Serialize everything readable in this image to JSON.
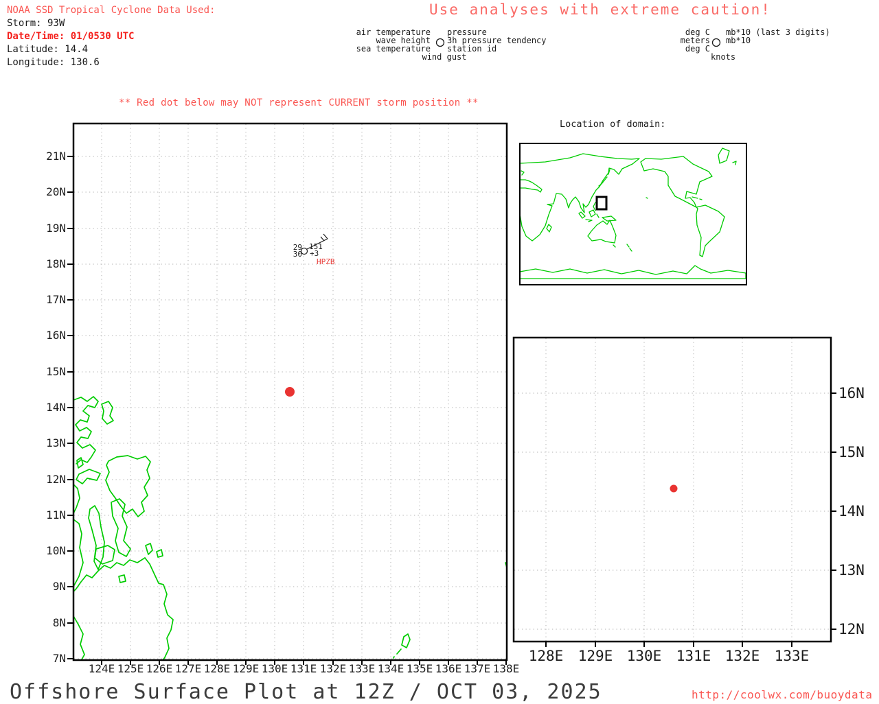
{
  "header": {
    "noaa_line": "NOAA SSD Tropical Cyclone Data Used:",
    "storm": "Storm: 93W",
    "datetime": "Date/Time: 01/0530 UTC",
    "latitude": "Latitude: 14.4",
    "longitude": "Longitude: 130.6"
  },
  "caution": "Use analyses with extreme caution!",
  "storm_warning": "** Red dot below may NOT represent CURRENT storm position **",
  "station_legend": {
    "air_temperature": "air temperature",
    "pressure": "pressure",
    "wave_height": "wave height",
    "pressure_tendency": "3h pressure tendency",
    "sea_temperature": "sea temperature",
    "station_id": "station id",
    "wind_gust": "wind gust"
  },
  "units_legend": {
    "air_temp_unit": "deg C",
    "pressure_unit": "mb*10 (last 3 digits)",
    "wave_height_unit": "meters",
    "tendency_unit": "mb*10",
    "sea_temp_unit": "deg C",
    "wind_gust_unit": "knots"
  },
  "main_map": {
    "lon_labels": [
      "124E",
      "125E",
      "126E",
      "127E",
      "128E",
      "129E",
      "130E",
      "131E",
      "132E",
      "133E",
      "134E",
      "135E",
      "136E",
      "137E",
      "138E"
    ],
    "lat_labels": [
      "21N",
      "20N",
      "19N",
      "18N",
      "17N",
      "16N",
      "15N",
      "14N",
      "13N",
      "12N",
      "11N",
      "10N",
      "9N",
      "8N",
      "7N"
    ],
    "storm_dot": {
      "longitude": 130.6,
      "latitude": 14.4
    },
    "station": {
      "air_temp": "29",
      "sea_temp": "30",
      "pressure": "151",
      "tendency": "+3",
      "id": "HPZB"
    }
  },
  "inset": {
    "title": "Location of domain:",
    "domain_box": {
      "lon_min": 123,
      "lon_max": 138,
      "lat_min": 7,
      "lat_max": 22
    }
  },
  "zoom_map": {
    "lon_labels": [
      "128E",
      "129E",
      "130E",
      "131E",
      "132E",
      "133E"
    ],
    "lat_labels": [
      "16N",
      "15N",
      "14N",
      "13N",
      "12N"
    ],
    "storm_dot": {
      "longitude": 130.6,
      "latitude": 14.4
    }
  },
  "footer": {
    "title": "Offshore Surface Plot at 12Z / OCT 03, 2025",
    "url": "http://coolwx.com/buoydata"
  },
  "colors": {
    "red_text": "#fa5551",
    "red_bold_text": "#f5211d",
    "salmon_text": "#fa6a66",
    "storm_dot": "#e93331",
    "coastline_green": "#00cc00",
    "grid_gray": "#b0b0b0",
    "station_id_red": "#e8403c"
  }
}
